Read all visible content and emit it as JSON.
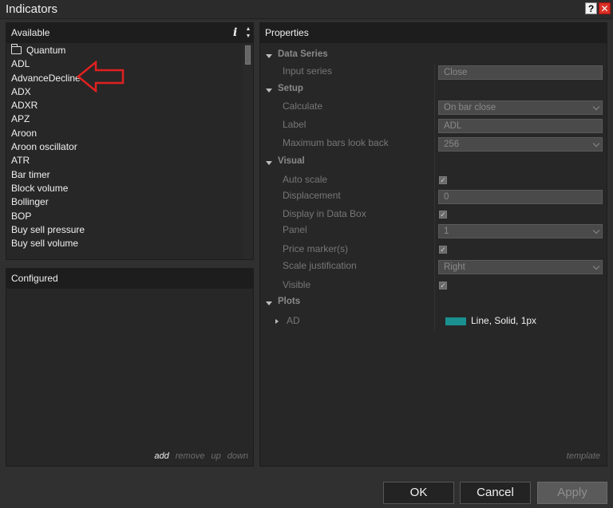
{
  "window": {
    "title": "Indicators",
    "help_glyph": "?",
    "close_glyph": "✕"
  },
  "available": {
    "header": "Available",
    "info_glyph": "i",
    "items": [
      "Quantum",
      "ADL",
      "AdvanceDecline",
      "ADX",
      "ADXR",
      "APZ",
      "Aroon",
      "Aroon oscillator",
      "ATR",
      "Bar timer",
      "Block volume",
      "Bollinger",
      "BOP",
      "Buy sell pressure",
      "Buy sell volume"
    ],
    "annotation_color": "#e02020"
  },
  "configured": {
    "header": "Configured",
    "actions": {
      "add": "add",
      "remove": "remove",
      "up": "up",
      "down": "down"
    }
  },
  "properties": {
    "header": "Properties",
    "data_series": {
      "title": "Data Series",
      "input_series_label": "Input series",
      "input_series_value": "Close"
    },
    "setup": {
      "title": "Setup",
      "calculate_label": "Calculate",
      "calculate_value": "On bar close",
      "label_label": "Label",
      "label_value": "ADL",
      "max_bars_label": "Maximum bars look back",
      "max_bars_value": "256"
    },
    "visual": {
      "title": "Visual",
      "auto_scale_label": "Auto scale",
      "auto_scale_checked": true,
      "displacement_label": "Displacement",
      "displacement_value": "0",
      "display_in_data_box_label": "Display in Data Box",
      "display_in_data_box_checked": true,
      "panel_label": "Panel",
      "panel_value": "1",
      "price_markers_label": "Price marker(s)",
      "price_markers_checked": true,
      "scale_justification_label": "Scale justification",
      "scale_justification_value": "Right",
      "visible_label": "Visible",
      "visible_checked": true
    },
    "plots": {
      "title": "Plots",
      "ad_label": "AD",
      "ad_value": "Line, Solid, 1px",
      "ad_color": "#1a9090"
    },
    "template_link": "template"
  },
  "buttons": {
    "ok": "OK",
    "cancel": "Cancel",
    "apply": "Apply"
  },
  "check_glyph": "✓"
}
